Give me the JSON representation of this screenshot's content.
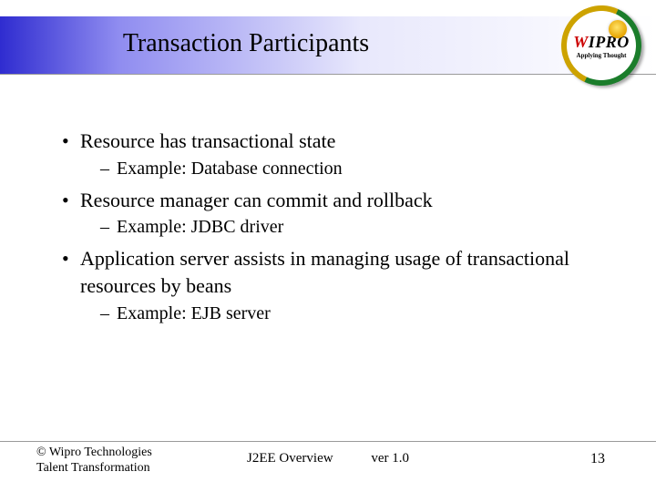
{
  "title": "Transaction Participants",
  "logo": {
    "brand": "WIPRO",
    "tagline": "Applying Thought"
  },
  "bullets": [
    {
      "text": "Resource has transactional state",
      "sub": [
        {
          "text": "Example: Database connection"
        }
      ]
    },
    {
      "text": "Resource manager can commit and rollback",
      "sub": [
        {
          "text": "Example: JDBC driver"
        }
      ]
    },
    {
      "text": "Application server assists in managing usage of transactional resources by beans",
      "sub": [
        {
          "text": "Example: EJB server"
        }
      ]
    }
  ],
  "footer": {
    "left_line1": "© Wipro Technologies",
    "left_line2": "Talent Transformation",
    "center": "J2EE Overview",
    "version": "ver 1.0",
    "page": "13"
  }
}
